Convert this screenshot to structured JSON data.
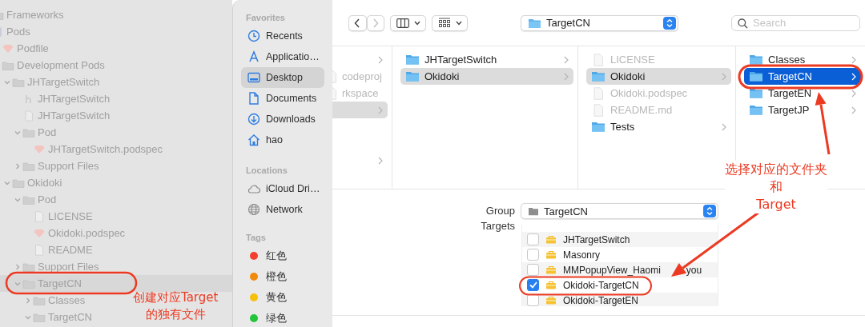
{
  "navigator": {
    "items": [
      {
        "name": "Frameworks",
        "kind": "folder"
      },
      {
        "name": "Pods",
        "kind": "project",
        "children": [
          {
            "name": "Podfile",
            "kind": "ruby"
          },
          {
            "name": "Development Pods",
            "kind": "folder",
            "children": [
              {
                "name": "JHTargetSwitch",
                "kind": "folder",
                "expanded": true,
                "children": [
                  {
                    "name": "JHTargetSwitch",
                    "kind": "header"
                  },
                  {
                    "name": "JHTargetSwitch",
                    "kind": "source"
                  },
                  {
                    "name": "Pod",
                    "kind": "folder",
                    "expanded": true,
                    "children": [
                      {
                        "name": "JHTargetSwitch.podspec",
                        "kind": "ruby"
                      }
                    ]
                  },
                  {
                    "name": "Support Files",
                    "kind": "folder",
                    "expanded": false
                  }
                ]
              },
              {
                "name": "Okidoki",
                "kind": "folder",
                "expanded": true,
                "children": [
                  {
                    "name": "Pod",
                    "kind": "folder",
                    "expanded": true,
                    "children": [
                      {
                        "name": "LICENSE",
                        "kind": "doc"
                      },
                      {
                        "name": "Okidoki.podspec",
                        "kind": "ruby"
                      },
                      {
                        "name": "README",
                        "kind": "doc"
                      }
                    ]
                  },
                  {
                    "name": "Support Files",
                    "kind": "folder",
                    "expanded": false
                  },
                  {
                    "name": "TargetCN",
                    "kind": "folder",
                    "expanded": true,
                    "selected": true,
                    "children": [
                      {
                        "name": "Classes",
                        "kind": "folder",
                        "expanded": false
                      },
                      {
                        "name": "TargetCN",
                        "kind": "folder",
                        "expanded": true
                      }
                    ]
                  }
                ]
              }
            ]
          }
        ]
      }
    ]
  },
  "sidebar": {
    "sections": [
      {
        "title": "Favorites",
        "items": [
          {
            "label": "Recents",
            "selected": false
          },
          {
            "label": "Applicatio…",
            "selected": false
          },
          {
            "label": "Desktop",
            "selected": true
          },
          {
            "label": "Documents",
            "selected": false
          },
          {
            "label": "Downloads",
            "selected": false
          },
          {
            "label": "hao",
            "selected": false
          }
        ]
      },
      {
        "title": "Locations",
        "items": [
          {
            "label": "iCloud Dri…",
            "selected": false
          },
          {
            "label": "Network",
            "selected": false
          }
        ]
      },
      {
        "title": "Tags",
        "items": [
          {
            "label": "红色",
            "selected": false,
            "color": "#f2402f"
          },
          {
            "label": "橙色",
            "selected": false,
            "color": "#f08a0c"
          },
          {
            "label": "黄色",
            "selected": false,
            "color": "#f5c00c"
          },
          {
            "label": "绿色",
            "selected": false,
            "color": "#22c43a"
          }
        ]
      }
    ]
  },
  "toolbar": {
    "path": "TargetCN",
    "search": {
      "placeholder": "Search"
    }
  },
  "browser": {
    "columns": [
      {
        "focused": false,
        "items": [
          {
            "has_children": true,
            "selected": false
          },
          {
            "name": "codeproj",
            "kind": "file",
            "disabled": true,
            "has_children": false,
            "selected": false
          },
          {
            "name": "rkspace",
            "kind": "file",
            "disabled": true,
            "has_children": false,
            "selected": false
          },
          {
            "has_children": true,
            "selected": true
          },
          {
            "has_children": false,
            "selected": false
          },
          {
            "has_children": false,
            "selected": false
          },
          {
            "has_children": true,
            "selected": false
          }
        ]
      },
      {
        "focused": false,
        "items": [
          {
            "name": "JHTargetSwitch",
            "kind": "folder",
            "disabled": false,
            "has_children": true,
            "selected": false
          },
          {
            "name": "Okidoki",
            "kind": "folder",
            "disabled": false,
            "has_children": true,
            "selected": true
          }
        ]
      },
      {
        "focused": false,
        "items": [
          {
            "name": "LICENSE",
            "kind": "file",
            "disabled": true,
            "has_children": false,
            "selected": false
          },
          {
            "name": "Okidoki",
            "kind": "folder",
            "disabled": false,
            "has_children": true,
            "selected": true
          },
          {
            "name": "Okidoki.podspec",
            "kind": "file",
            "disabled": true,
            "has_children": false,
            "selected": false
          },
          {
            "name": "README.md",
            "kind": "file",
            "disabled": true,
            "has_children": false,
            "selected": false
          },
          {
            "name": "Tests",
            "kind": "folder",
            "disabled": false,
            "has_children": true,
            "selected": false
          }
        ]
      },
      {
        "focused": true,
        "items": [
          {
            "name": "Classes",
            "kind": "folder",
            "disabled": false,
            "has_children": true,
            "selected": false
          },
          {
            "name": "TargetCN",
            "kind": "folder",
            "disabled": false,
            "has_children": true,
            "selected": true
          },
          {
            "name": "TargetEN",
            "kind": "folder",
            "disabled": false,
            "has_children": true,
            "selected": false
          },
          {
            "name": "TargetJP",
            "kind": "folder",
            "disabled": false,
            "has_children": true,
            "selected": false
          }
        ]
      }
    ]
  },
  "group": {
    "label": "Group",
    "value": "TargetCN"
  },
  "targets": {
    "label": "Targets",
    "items": [
      {
        "name": "JHTargetSwitch",
        "checked": false
      },
      {
        "name": "Masonry",
        "checked": false
      },
      {
        "name": "MMPopupView_Haomi",
        "name_end": "you",
        "checked": false
      },
      {
        "name": "Okidoki-TargetCN",
        "checked": true
      },
      {
        "name": "Okidoki-TargetEN",
        "checked": false
      }
    ]
  },
  "annotations": [
    {
      "lines": [
        "创建对应Target",
        "的独有文件"
      ]
    },
    {
      "lines": [
        "选择对应的文件夹",
        "和",
        "Target"
      ]
    }
  ]
}
